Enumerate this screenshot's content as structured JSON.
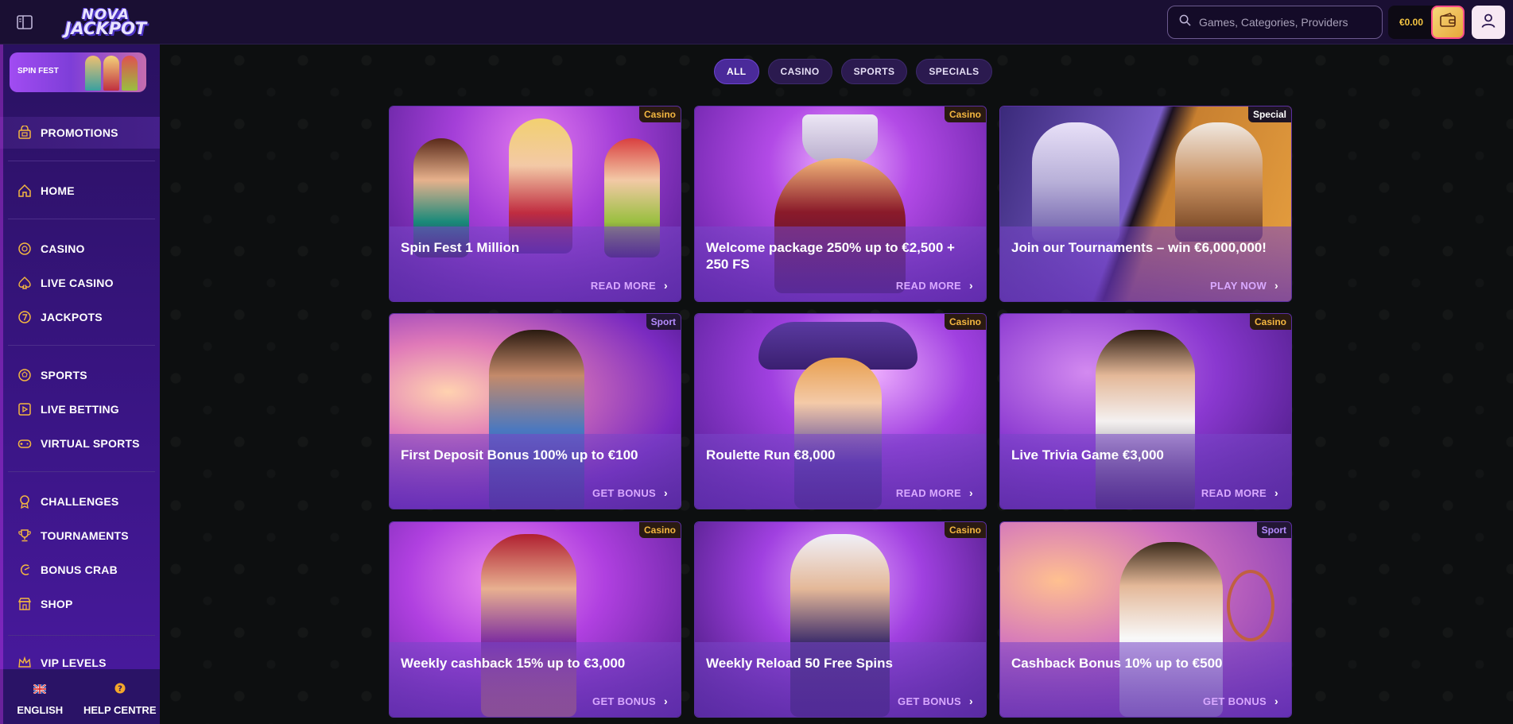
{
  "header": {
    "logo_line1": "NOVA",
    "logo_line2": "JACKPOT",
    "search_placeholder": "Games, Categories, Providers",
    "balance": "€0.00"
  },
  "sidebar": {
    "banner": "SPIN FEST",
    "items": [
      {
        "label": "PROMOTIONS",
        "icon": "gift-bag-icon"
      },
      {
        "label": "HOME",
        "icon": "home-icon"
      },
      {
        "label": "CASINO",
        "icon": "casino-chip-icon"
      },
      {
        "label": "LIVE CASINO",
        "icon": "spade-icon"
      },
      {
        "label": "JACKPOTS",
        "icon": "seven-coin-icon"
      },
      {
        "label": "SPORTS",
        "icon": "ball-icon"
      },
      {
        "label": "LIVE BETTING",
        "icon": "play-screen-icon"
      },
      {
        "label": "VIRTUAL SPORTS",
        "icon": "gamepad-icon"
      },
      {
        "label": "CHALLENGES",
        "icon": "medal-icon"
      },
      {
        "label": "TOURNAMENTS",
        "icon": "trophy-icon"
      },
      {
        "label": "BONUS CRAB",
        "icon": "crab-icon"
      },
      {
        "label": "SHOP",
        "icon": "shop-icon"
      },
      {
        "label": "VIP LEVELS",
        "icon": "crown-icon"
      }
    ],
    "footer": {
      "language": "ENGLISH",
      "help": "HELP CENTRE"
    }
  },
  "filters": [
    "ALL",
    "CASINO",
    "SPORTS",
    "SPECIALS"
  ],
  "active_filter": "ALL",
  "promotions": [
    {
      "tag": "Casino",
      "title": "Spin Fest 1 Million",
      "cta": "READ MORE"
    },
    {
      "tag": "Casino",
      "title": "Welcome package 250% up to €2,500 + 250 FS",
      "cta": "READ MORE"
    },
    {
      "tag": "Special",
      "title": "Join our Tournaments – win €6,000,000!",
      "cta": "PLAY NOW"
    },
    {
      "tag": "Sport",
      "title": "First Deposit Bonus 100% up to €100",
      "cta": "GET BONUS"
    },
    {
      "tag": "Casino",
      "title": "Roulette Run €8,000",
      "cta": "READ MORE"
    },
    {
      "tag": "Casino",
      "title": "Live Trivia Game €3,000",
      "cta": "READ MORE"
    },
    {
      "tag": "Casino",
      "title": "Weekly cashback 15% up to €3,000",
      "cta": "GET BONUS"
    },
    {
      "tag": "Casino",
      "title": "Weekly Reload 50 Free Spins",
      "cta": "GET BONUS"
    },
    {
      "tag": "Sport",
      "title": "Cashback Bonus 10% up to €500",
      "cta": "GET BONUS"
    }
  ],
  "colors": {
    "accent": "#7b3fe4",
    "sidebar_bg": "#2a1161",
    "tag_gold": "#f4b740",
    "cta": "#d9a9ff"
  }
}
